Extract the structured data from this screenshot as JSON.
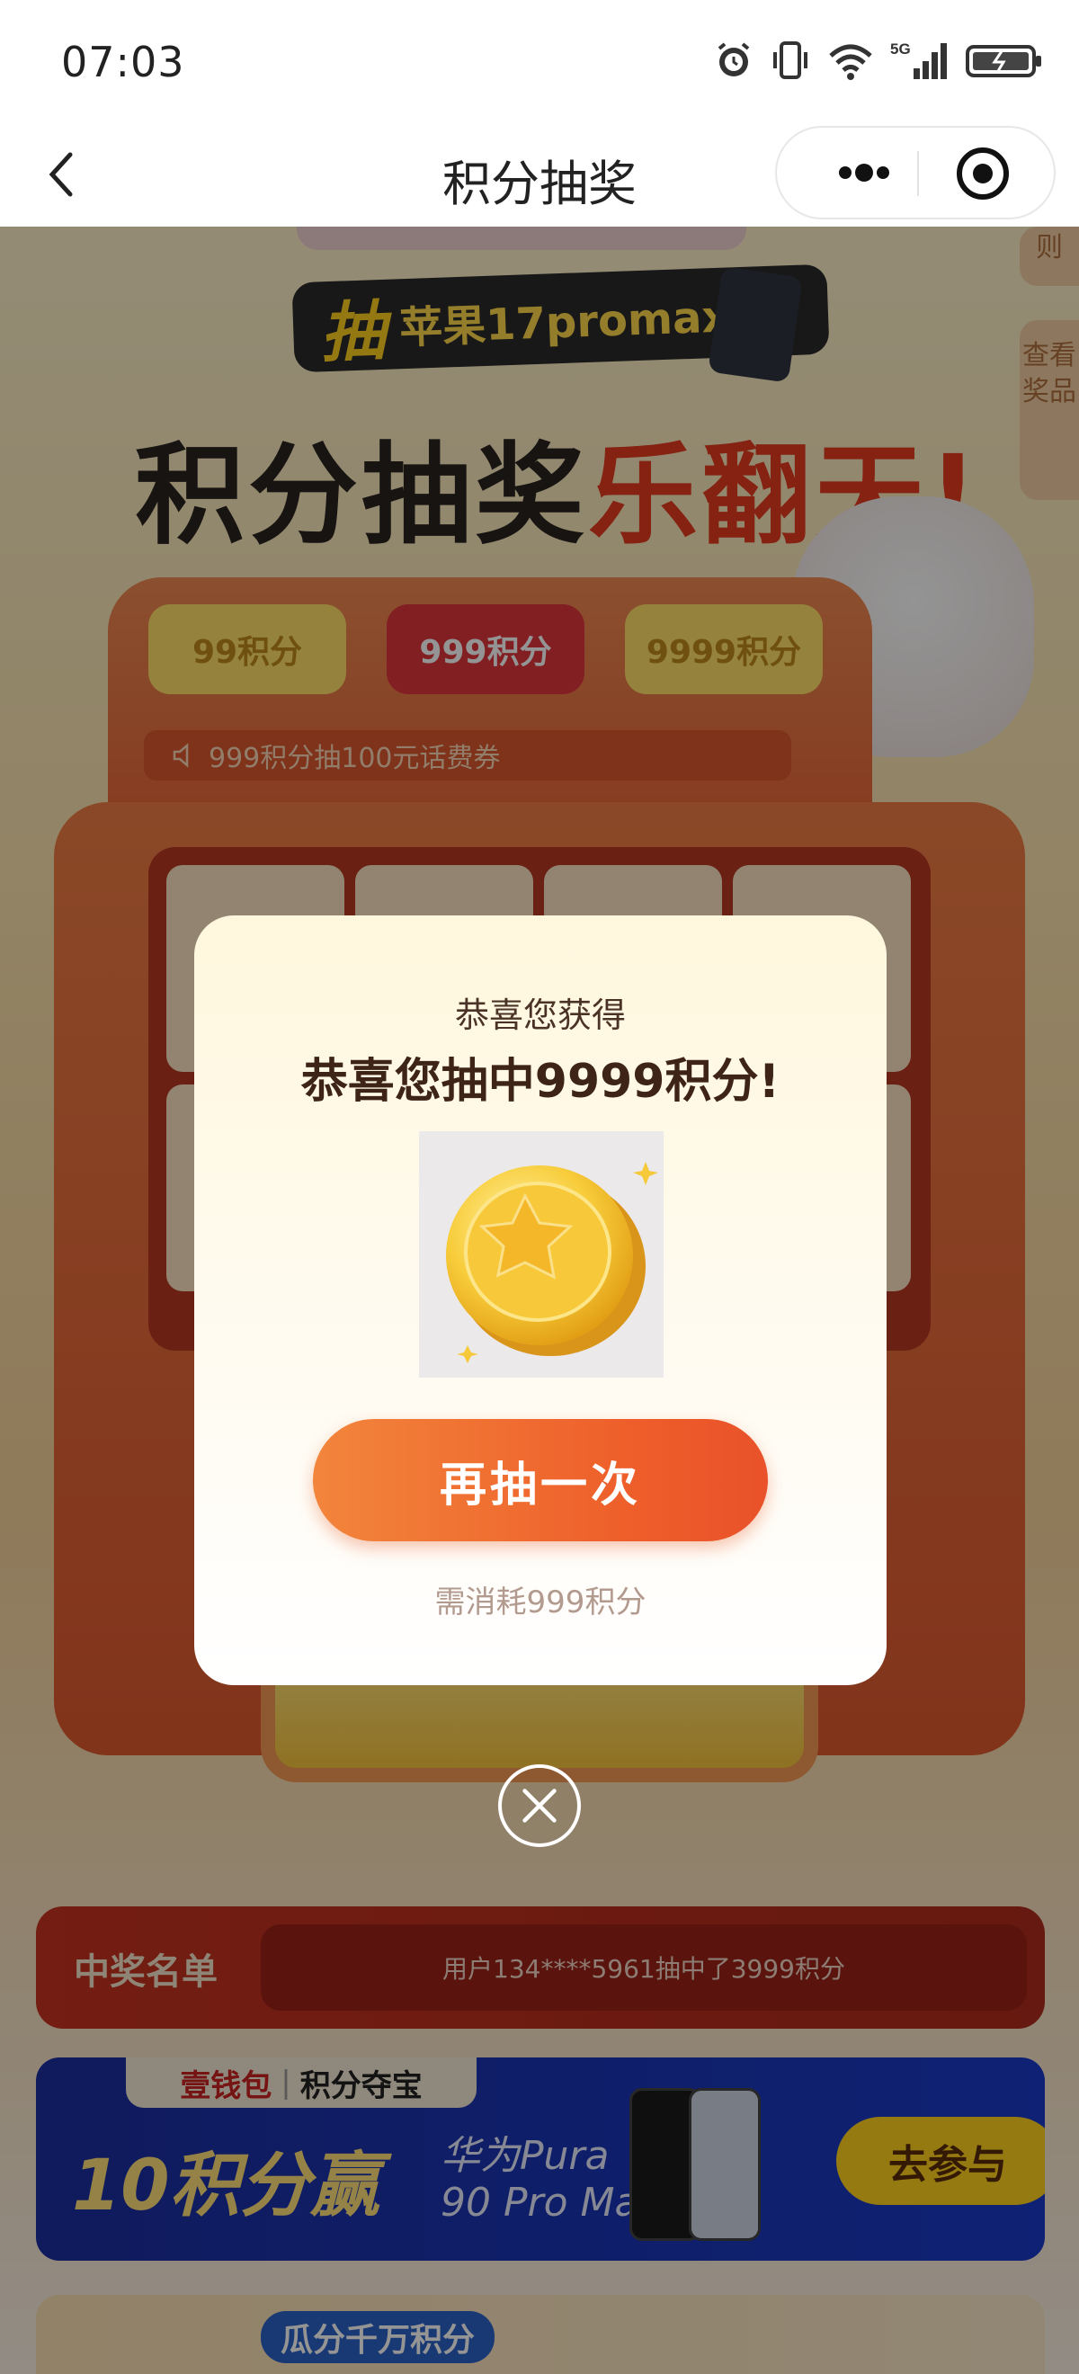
{
  "status_bar": {
    "time": "07:03",
    "network": "5G",
    "icons": [
      "alarm-icon",
      "vibrate-icon",
      "wifi-icon",
      "signal-icon",
      "battery-icon"
    ]
  },
  "nav": {
    "title": "积分抽奖",
    "back_icon": "chevron-left-icon",
    "more_icon": "more-dots-icon",
    "close_icon": "target-icon"
  },
  "background": {
    "tag_chou": "抽",
    "tag_model": "苹果17promax",
    "hero_left": "积分抽奖",
    "hero_right": "乐翻天!",
    "side_rule": "则",
    "side_prize": "查看奖品",
    "tiers": [
      "99积分",
      "999积分",
      "9999积分"
    ],
    "notice": "999积分抽100元话费券",
    "winners_title": "中奖名单",
    "winners_ticker": "用户134****5961抽中了3999积分",
    "ad": {
      "brand": "壹钱包",
      "pipe": "|",
      "brand_sub": "积分夺宝",
      "main": "10积分赢",
      "sub_line1": "华为Pura",
      "sub_line2": "90 Pro Max",
      "button": "去参与"
    },
    "bottom_tag": "瓜分千万积分"
  },
  "modal": {
    "subtitle": "恭喜您获得",
    "title": "恭喜您抽中9999积分!",
    "prize_icon": "gold-star-coin-icon",
    "button": "再抽一次",
    "cost": "需消耗999积分",
    "close_icon": "close-icon"
  },
  "colors": {
    "primary_button": "#ee5e2a",
    "modal_title": "#3e2417",
    "overlay": "rgba(0,0,0,0.42)"
  }
}
